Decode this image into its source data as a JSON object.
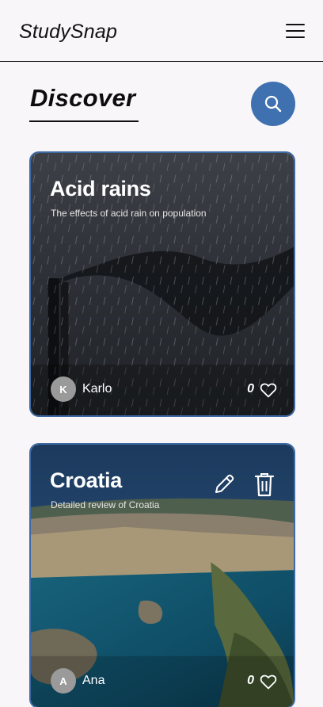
{
  "app": {
    "title": "StudySnap"
  },
  "header": {
    "menu_icon": "hamburger-menu-icon"
  },
  "page": {
    "heading": "Discover",
    "search_icon": "search-icon"
  },
  "posts": [
    {
      "title": "Acid rains",
      "subtitle": "The effects of acid rain on population",
      "author": "Karlo",
      "author_initial": "K",
      "likes": "0",
      "image": "rainy-smokestack-photo"
    },
    {
      "title": "Croatia",
      "subtitle": "Detailed review of Croatia",
      "author": "Ana",
      "author_initial": "A",
      "likes": "0",
      "image": "dubrovnik-coast-photo",
      "actions": [
        "edit-icon",
        "delete-icon"
      ]
    }
  ],
  "colors": {
    "accent": "#3f71b0",
    "card_border": "#3d6aa3",
    "background": "#f8f6f8"
  }
}
